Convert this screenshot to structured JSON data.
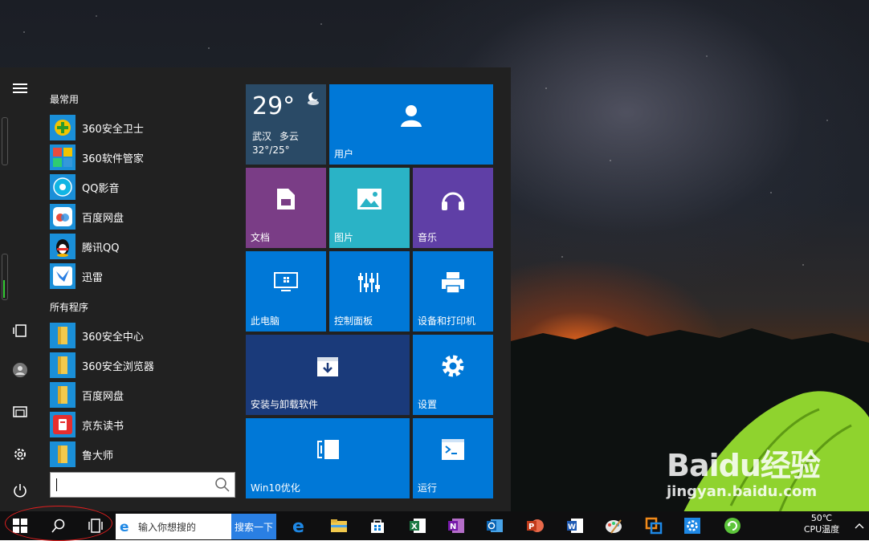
{
  "start_menu": {
    "most_used_header": "最常用",
    "all_programs_header": "所有程序",
    "most_used": [
      {
        "label": "360安全卫士",
        "icon": "360-safe-guard-icon"
      },
      {
        "label": "360软件管家",
        "icon": "360-software-manager-icon"
      },
      {
        "label": "QQ影音",
        "icon": "qq-player-icon"
      },
      {
        "label": "百度网盘",
        "icon": "baidu-netdisk-icon"
      },
      {
        "label": "腾讯QQ",
        "icon": "qq-penguin-icon"
      },
      {
        "label": "迅雷",
        "icon": "xunlei-bird-icon"
      }
    ],
    "all_programs": [
      {
        "label": "360安全中心",
        "icon": "folder-icon"
      },
      {
        "label": "360安全浏览器",
        "icon": "folder-icon"
      },
      {
        "label": "百度网盘",
        "icon": "folder-icon"
      },
      {
        "label": "京东读书",
        "icon": "jd-reader-icon"
      },
      {
        "label": "鲁大师",
        "icon": "folder-icon"
      }
    ],
    "search_value": ""
  },
  "tiles": {
    "weather": {
      "temp": "29°",
      "city": "武汉",
      "condition": "多云",
      "range": "32°/25°"
    },
    "user": "用户",
    "documents": "文档",
    "pictures": "图片",
    "music": "音乐",
    "this_pc": "此电脑",
    "control_panel": "控制面板",
    "devices_printers": "设备和打印机",
    "install_uninstall": "安装与卸载软件",
    "settings": "设置",
    "win10_optimize": "Win10优化",
    "run": "运行"
  },
  "taskbar": {
    "search_placeholder": "输入你想搜的",
    "search_button": "搜索一下",
    "cpu_temp": "50℃",
    "cpu_label": "CPU温度"
  },
  "watermark": {
    "logo_text": "Baidu经验",
    "url": "jingyan.baidu.com"
  },
  "colors": {
    "tile_blue": "#0078d7",
    "tile_purple": "#7a3d86",
    "tile_teal": "#2ab3c6",
    "tile_violet": "#5f3fa6",
    "tile_navy": "#1a3a7a",
    "weather_bg": "#2a4a66",
    "highlight_circle": "#e01f1f"
  }
}
